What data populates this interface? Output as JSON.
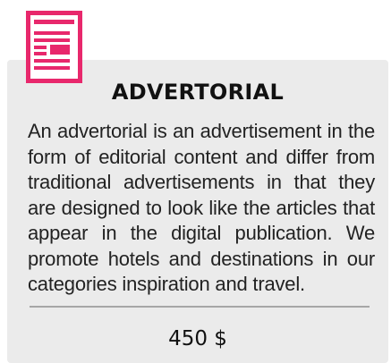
{
  "card": {
    "icon": "advertorial-document-icon",
    "title": "ADVERTORIAL",
    "description": "An advertorial is an advertisement in the form of editorial content and differ from traditional advertisements in that they are designed to look like the articles that appear in the digital publication. We promote hotels and destinations in our categories inspiration and travel.",
    "price": "450 $"
  },
  "colors": {
    "accent": "#e8286c",
    "card_background": "#ebebeb",
    "divider": "#a6a6a6",
    "text": "#222222"
  }
}
